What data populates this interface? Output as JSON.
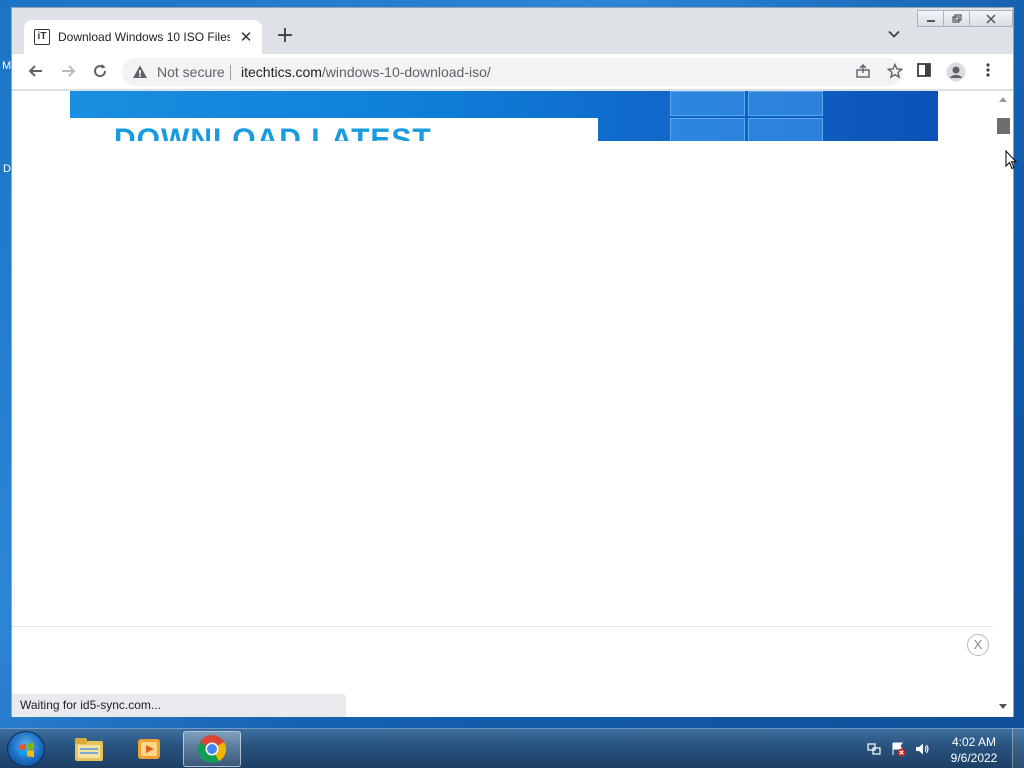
{
  "desktop": {
    "left_edge_labels": [
      "M",
      "D"
    ]
  },
  "window": {
    "tab": {
      "favicon_text": "iT",
      "title": "Download Windows 10 ISO Files",
      "close_glyph": "✕"
    },
    "new_tab_glyph": "+",
    "controls": {
      "minimize": "—",
      "restore": "❐",
      "close": "✕"
    }
  },
  "toolbar": {
    "security_label": "Not secure",
    "url_host": "itechtics.com",
    "url_path": "/windows-10-download-iso/"
  },
  "page": {
    "banner_text": "DOWNLOAD LATEST",
    "ad_close_label": "X",
    "status_text": "Waiting for id5-sync.com..."
  },
  "taskbar": {
    "time": "4:02 AM",
    "date": "9/6/2022"
  },
  "colors": {
    "banner_blue": "#1a8ee0",
    "banner_text": "#1a9be0",
    "taskbar": "#28527e"
  }
}
